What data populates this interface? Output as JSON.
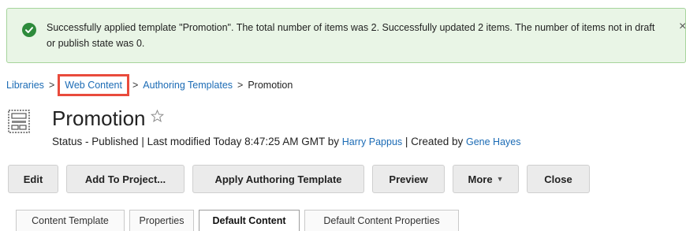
{
  "alert": {
    "message": "Successfully applied template \"Promotion\". The total number of items was 2. Successfully updated 2 items. The number of items not in draft or publish state was 0.",
    "close_glyph": "×",
    "icon": "check-circle-icon",
    "color": "#2e8b3c"
  },
  "breadcrumb": {
    "items": [
      "Libraries",
      "Web Content",
      "Authoring Templates"
    ],
    "current": "Promotion",
    "separator": ">",
    "highlight_color": "#e94b3c"
  },
  "page": {
    "title": "Promotion",
    "status_prefix": "Status - Published | Last modified Today 8:47:25 AM GMT by",
    "modified_by": "Harry Pappus",
    "created_sep": "| Created by",
    "created_by": "Gene Hayes"
  },
  "toolbar": {
    "edit": "Edit",
    "add_to_project": "Add To Project...",
    "apply_template": "Apply Authoring Template",
    "preview": "Preview",
    "more": "More",
    "close": "Close"
  },
  "tabs": [
    "Content Template",
    "Properties",
    "Default Content",
    "Default Content Properties"
  ],
  "active_tab": "Default Content",
  "link_color": "#1b6bb5"
}
